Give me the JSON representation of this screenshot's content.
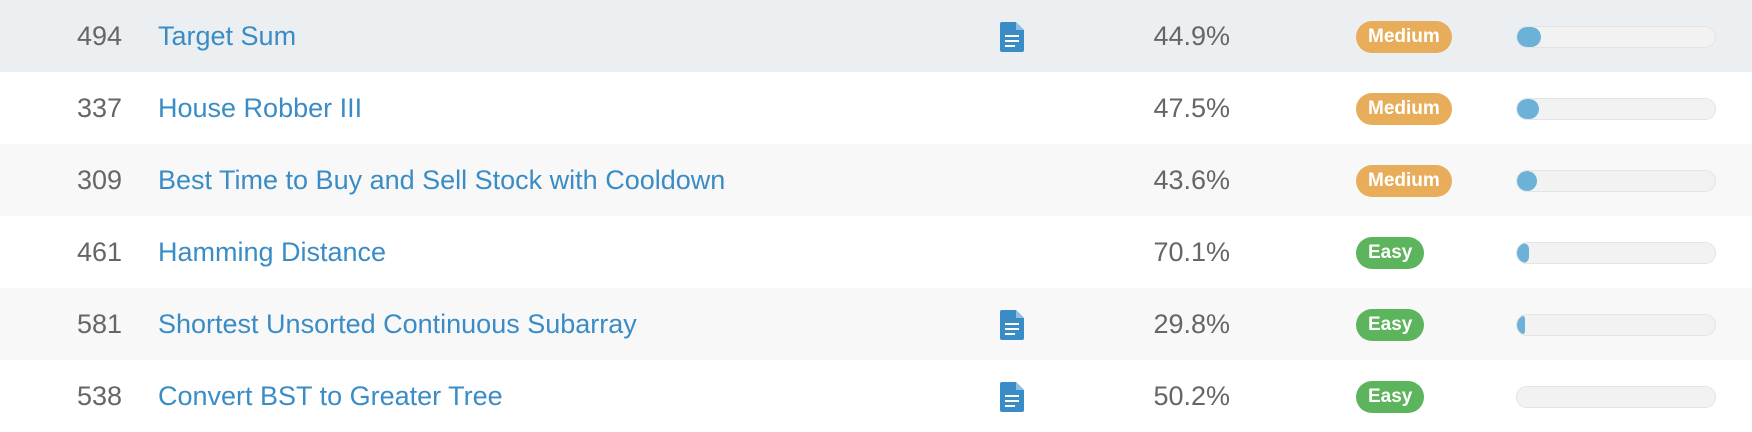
{
  "colors": {
    "link": "#3a8cc6",
    "medium": "#e8ad5a",
    "easy": "#5cb55c",
    "progress": "#6cb2d8"
  },
  "rows": [
    {
      "id": "494",
      "title": "Target Sum",
      "has_solution": true,
      "acceptance": "44.9%",
      "difficulty": "Medium",
      "level": "medium",
      "frequency": 0.12
    },
    {
      "id": "337",
      "title": "House Robber III",
      "has_solution": false,
      "acceptance": "47.5%",
      "difficulty": "Medium",
      "level": "medium",
      "frequency": 0.11
    },
    {
      "id": "309",
      "title": "Best Time to Buy and Sell Stock with Cooldown",
      "has_solution": false,
      "acceptance": "43.6%",
      "difficulty": "Medium",
      "level": "medium",
      "frequency": 0.1
    },
    {
      "id": "461",
      "title": "Hamming Distance",
      "has_solution": false,
      "acceptance": "70.1%",
      "difficulty": "Easy",
      "level": "easy",
      "frequency": 0.06
    },
    {
      "id": "581",
      "title": "Shortest Unsorted Continuous Subarray",
      "has_solution": true,
      "acceptance": "29.8%",
      "difficulty": "Easy",
      "level": "easy",
      "frequency": 0.03
    },
    {
      "id": "538",
      "title": "Convert BST to Greater Tree",
      "has_solution": true,
      "acceptance": "50.2%",
      "difficulty": "Easy",
      "level": "easy",
      "frequency": 0.0
    }
  ],
  "icons": {
    "solution": "document-icon"
  }
}
